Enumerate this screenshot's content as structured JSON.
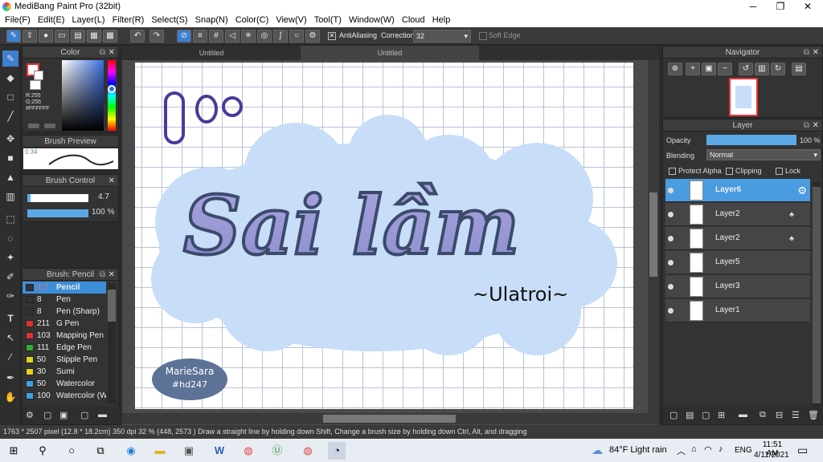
{
  "window": {
    "title": "MediBang Paint Pro (32bit)",
    "minimize": "─",
    "maximize": "❐",
    "close": "✕"
  },
  "menu": [
    "File(F)",
    "Edit(E)",
    "Layer(L)",
    "Filter(R)",
    "Select(S)",
    "Snap(N)",
    "Color(C)",
    "View(V)",
    "Tool(T)",
    "Window(W)",
    "Cloud",
    "Help"
  ],
  "toolbar": {
    "antialiasing": "AntiAliasing",
    "correction_label": "Correction",
    "correction_value": "32",
    "soft_edge": "Soft Edge"
  },
  "color_panel": {
    "title": "Color",
    "r": "R:255",
    "g": "G:255",
    "b": "B:255",
    "hex": "#FFFFFF"
  },
  "brush_preview": {
    "title": "Brush Preview",
    "size": "0.34"
  },
  "brush_control": {
    "title": "Brush Control",
    "size": "4.7",
    "opacity": "100 %"
  },
  "brush_list": {
    "title": "Brush: Pencil",
    "items": [
      {
        "size": "4.7",
        "name": "Pencil",
        "color": "#333333",
        "selected": true
      },
      {
        "size": "8",
        "name": "Pen",
        "color": "#333333"
      },
      {
        "size": "8",
        "name": "Pen (Sharp)",
        "color": "#333333"
      },
      {
        "size": "211",
        "name": "G Pen",
        "color": "#e03030"
      },
      {
        "size": "103",
        "name": "Mapping Pen",
        "color": "#e03030"
      },
      {
        "size": "111",
        "name": "Edge Pen",
        "color": "#30b030"
      },
      {
        "size": "50",
        "name": "Stipple Pen",
        "color": "#e6d020"
      },
      {
        "size": "30",
        "name": "Sumi",
        "color": "#e6d020"
      },
      {
        "size": "50",
        "name": "Watercolor",
        "color": "#40a0e0"
      },
      {
        "size": "100",
        "name": "Watercolor (We",
        "color": "#40a0e0"
      }
    ]
  },
  "tabs": [
    "Untitled",
    "Untitled"
  ],
  "artwork": {
    "title": "Sai lầm",
    "subtitle": "~Ulatroi~",
    "badge_line1": "MarieSara",
    "badge_line2": "#hd247",
    "doodle": "0°"
  },
  "navigator": {
    "title": "Navigator"
  },
  "layer_panel": {
    "title": "Layer",
    "opacity_label": "Opacity",
    "opacity_value": "100 %",
    "blending_label": "Blending",
    "blending_value": "Normal",
    "protect_alpha": "Protect Alpha",
    "clipping": "Clipping",
    "lock": "Lock",
    "layers": [
      "Layer6",
      "Layer2",
      "Layer2",
      "Layer5",
      "Layer3",
      "Layer1"
    ]
  },
  "status": {
    "text": "1763 * 2507 pixel  (12.8 * 18.2cm)  350 dpi  32 %  (448, 2573 )  Draw a straight line by holding down Shift, Change a brush size by holding down Ctrl, Alt, and dragging"
  },
  "taskbar": {
    "weather": "84°F  Light rain",
    "lang": "ENG",
    "time": "11:51 AM",
    "date": "4/11/2021"
  }
}
